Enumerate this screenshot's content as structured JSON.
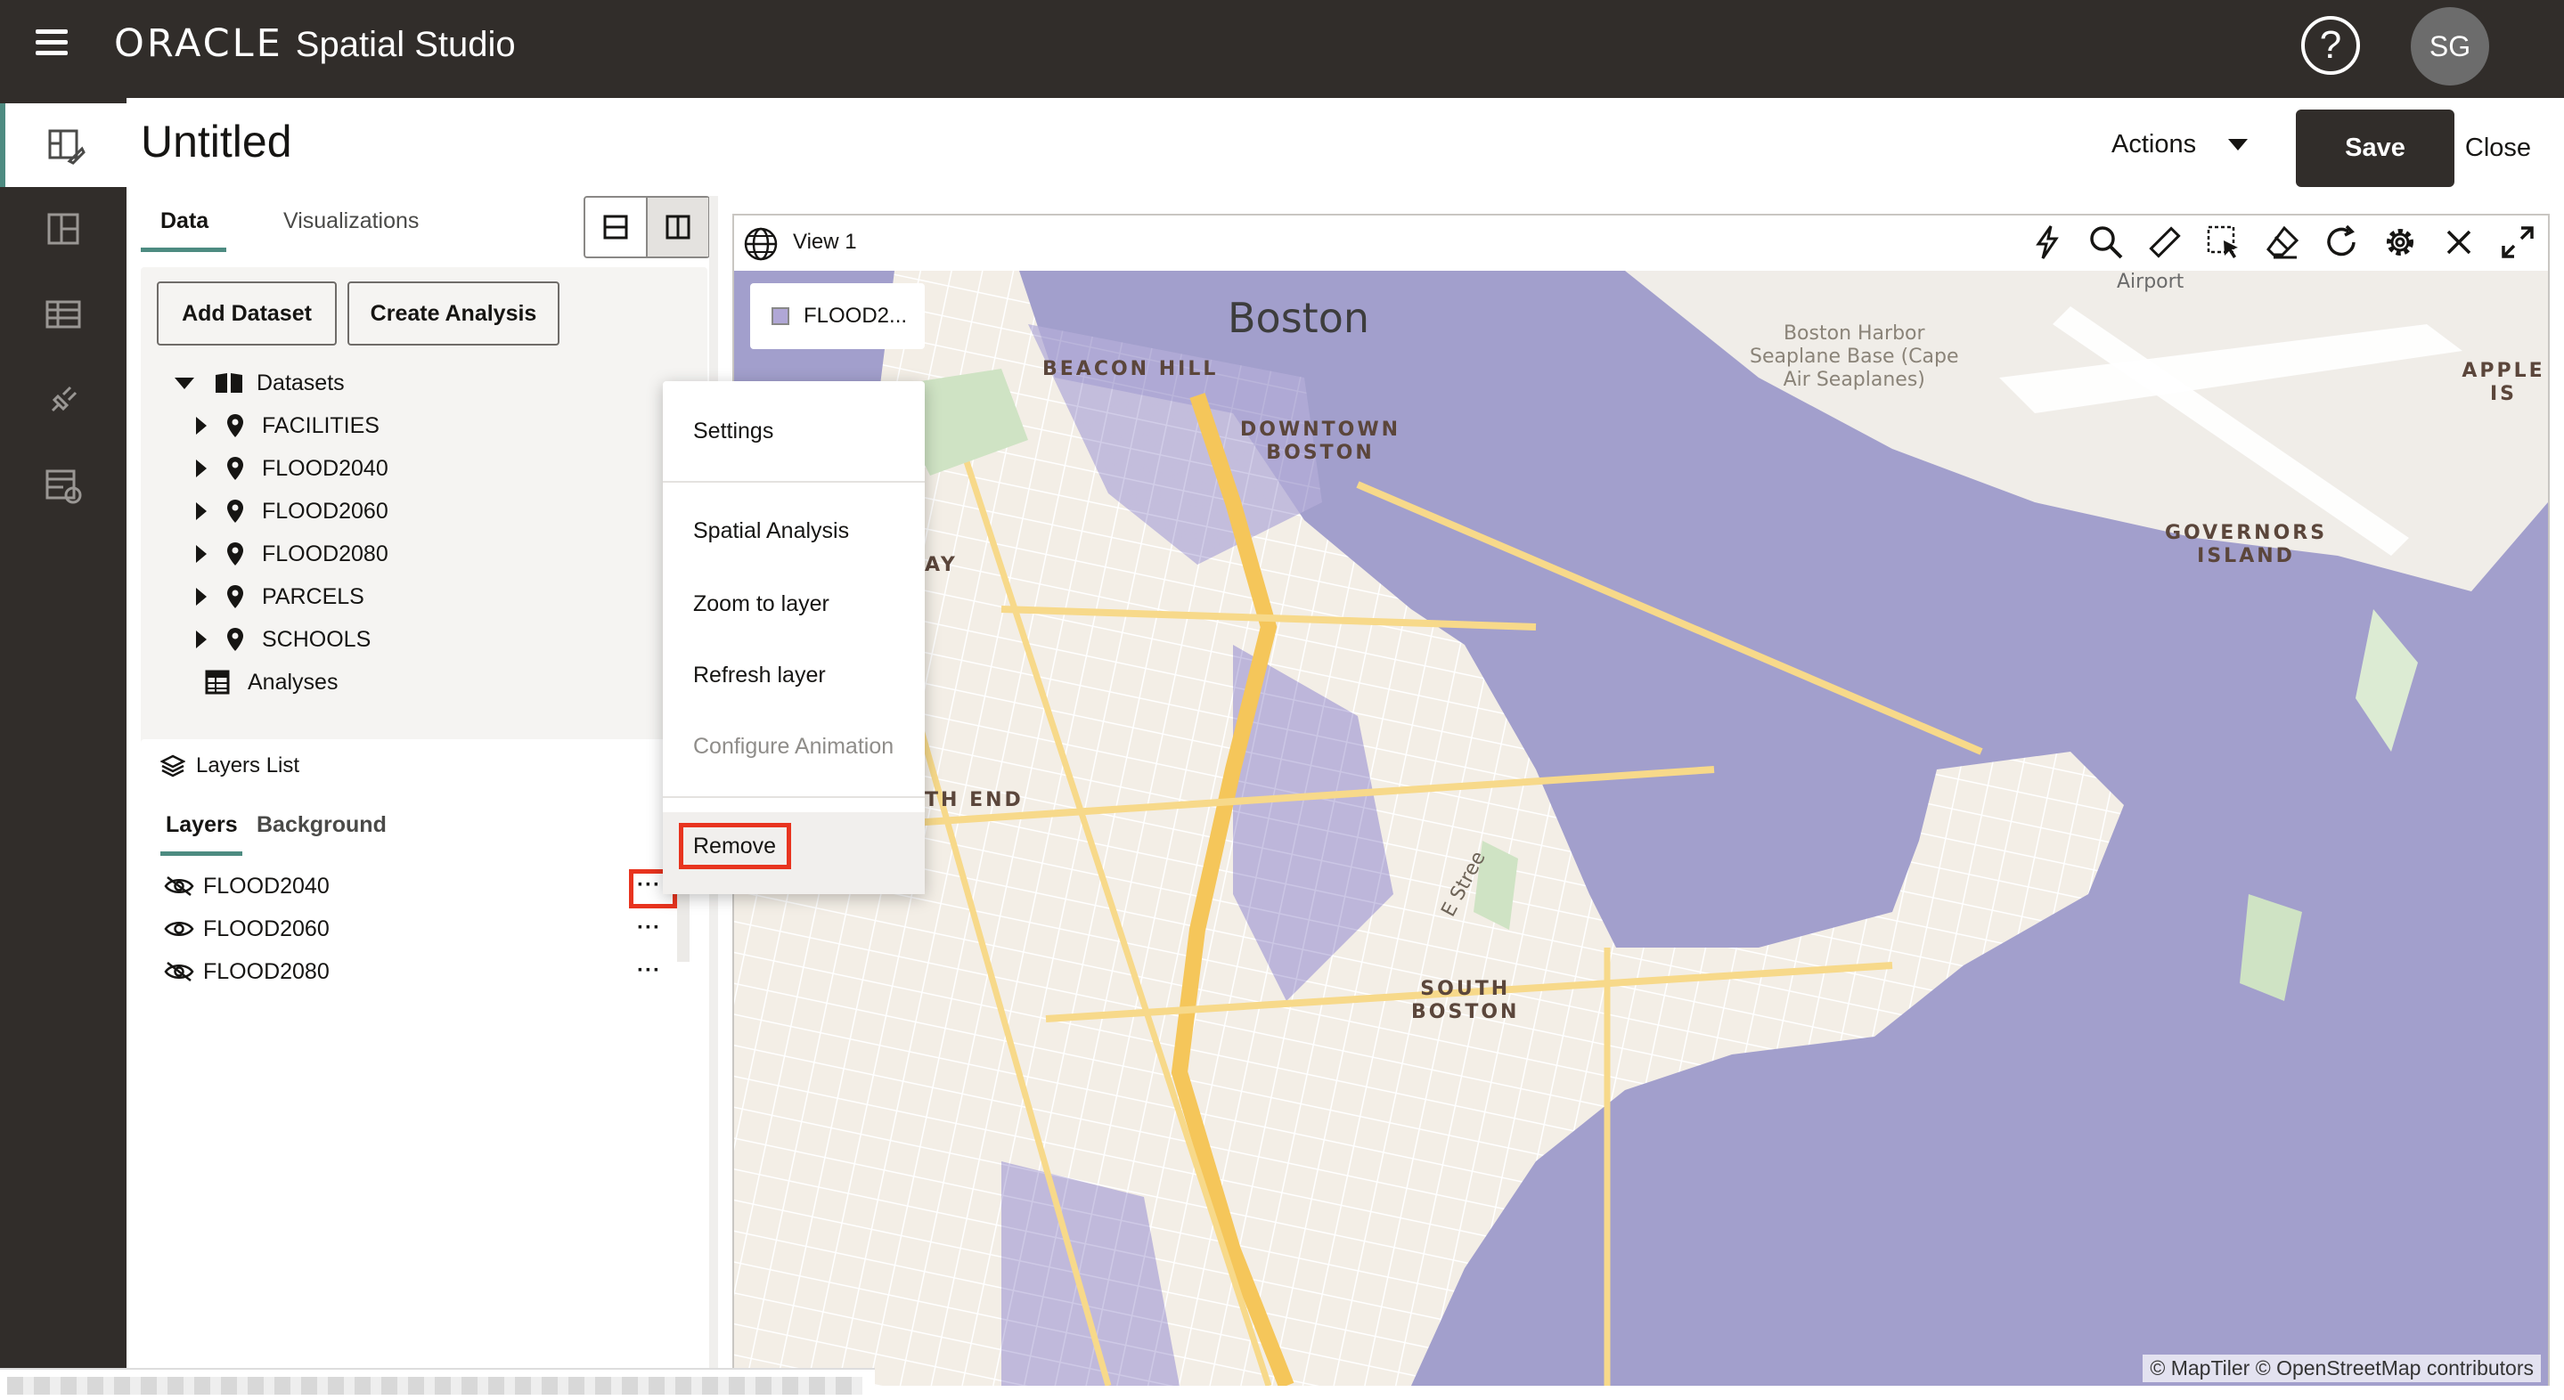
{
  "app": {
    "brand": "ORACLE",
    "product": "Spatial Studio",
    "help_glyph": "?",
    "user_initials": "SG"
  },
  "rail": {
    "items": [
      "project-icon",
      "dashboard-icon",
      "table-icon",
      "connections-icon",
      "jobs-icon"
    ]
  },
  "page": {
    "title": "Untitled",
    "actions_label": "Actions",
    "save_label": "Save",
    "close_label": "Close"
  },
  "panel": {
    "tabs": [
      "Data",
      "Visualizations"
    ],
    "add_dataset": "Add Dataset",
    "create_analysis": "Create Analysis",
    "datasets_label": "Datasets",
    "datasets": [
      "FACILITIES",
      "FLOOD2040",
      "FLOOD2060",
      "FLOOD2080",
      "PARCELS",
      "SCHOOLS"
    ],
    "analyses_label": "Analyses",
    "layers_list_label": "Layers List",
    "layer_tabs": [
      "Layers",
      "Background"
    ],
    "layers": [
      {
        "name": "FLOOD2040",
        "visible": false
      },
      {
        "name": "FLOOD2060",
        "visible": true
      },
      {
        "name": "FLOOD2080",
        "visible": false
      }
    ],
    "more_glyph": "···"
  },
  "context_menu": {
    "items": [
      "Settings",
      "Spatial Analysis",
      "Zoom to layer",
      "Refresh layer",
      "Configure Animation",
      "Remove"
    ],
    "disabled": [
      "Configure Animation"
    ],
    "highlighted": "Remove"
  },
  "map": {
    "view_title": "View 1",
    "legend_label": "FLOOD2...",
    "tools": [
      "lightning-icon",
      "search-icon",
      "ruler-icon",
      "select-icon",
      "eraser-icon",
      "refresh-icon",
      "gear-icon",
      "close-icon",
      "expand-icon"
    ],
    "labels": {
      "city": "Boston",
      "beacon_hill": "BEACON HILL",
      "downtown": "DOWNTOWN\nBOSTON",
      "harbor": "Boston Harbor\nSeaplane Base (Cape\nAir Seaplanes)",
      "airport": "Airport",
      "apple": "APPLE IS",
      "governors": "GOVERNORS\nISLAND",
      "south_end": "TH END",
      "way": "AY",
      "south_boston": "SOUTH\nBOSTON",
      "e_street": "E Stree"
    },
    "attribution": "© MapTiler  © OpenStreetMap contributors",
    "colors": {
      "water": "#a29fcc",
      "land": "#f3eee6",
      "roads": "#f5c65a",
      "flood": "#a59fd0"
    }
  },
  "colors": {
    "topbar": "#312d2a",
    "accent": "#4d8b81",
    "highlight": "#e8341f"
  }
}
